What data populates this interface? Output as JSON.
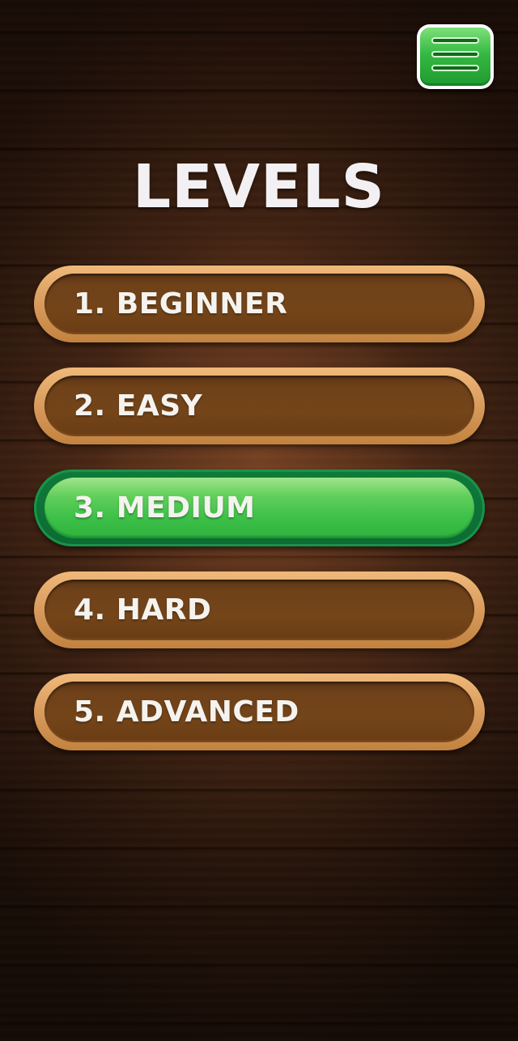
{
  "screen": {
    "title": "LEVELS"
  },
  "menu_button": {
    "icon": "hamburger-menu-icon"
  },
  "levels": [
    {
      "label": "1. BEGINNER",
      "selected": false
    },
    {
      "label": "2. EASY",
      "selected": false
    },
    {
      "label": "3. MEDIUM",
      "selected": true
    },
    {
      "label": "4. HARD",
      "selected": false
    },
    {
      "label": "5. ADVANCED",
      "selected": false
    }
  ],
  "colors": {
    "selected_accent": "#3ec149",
    "button_wood": "#744519",
    "button_rim": "#d89b5c",
    "title_text": "#f2f0f3"
  }
}
